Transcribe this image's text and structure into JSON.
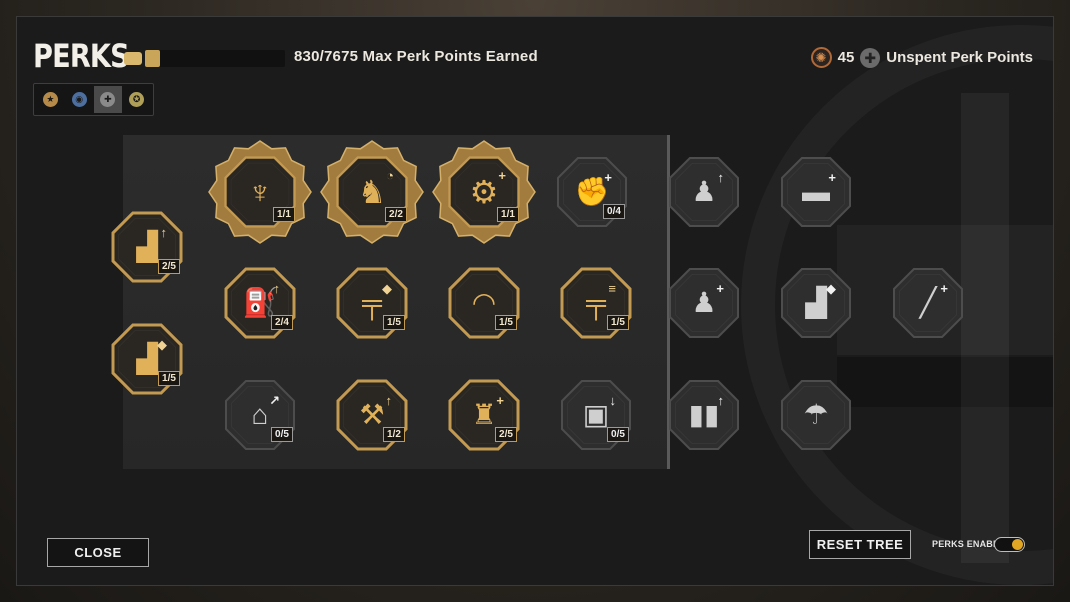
{
  "header": {
    "title": "PERKS",
    "points_text": "830/7675 Max Perk Points Earned",
    "points_progress": 0.108,
    "unspent_count": "45",
    "unspent_label": "Unspent Perk Points"
  },
  "factions": [
    {
      "name": "us-faction-icon",
      "color": "#b68b4a",
      "symbol": "★"
    },
    {
      "name": "uk-faction-icon",
      "color": "#4d6fa0",
      "symbol": "◉"
    },
    {
      "name": "german-faction-icon",
      "color": "#8a8a8a",
      "symbol": "✚"
    },
    {
      "name": "soviet-faction-icon",
      "color": "#b0a057",
      "symbol": "✪"
    }
  ],
  "perks": [
    {
      "glyph": "▟",
      "sub": "↑",
      "rank": "2/5",
      "state": "gold",
      "size": "normal"
    },
    {
      "glyph": "▟",
      "sub": "◆",
      "rank": "1/5",
      "state": "gold",
      "size": "normal"
    },
    {
      "glyph": "♆",
      "sub": "",
      "rank": "1/1",
      "state": "gold",
      "size": "big"
    },
    {
      "glyph": "♞",
      "sub": "◔",
      "rank": "2/2",
      "state": "gold",
      "size": "big"
    },
    {
      "glyph": "⚙",
      "sub": "+",
      "rank": "1/1",
      "state": "gold",
      "size": "big"
    },
    {
      "glyph": "✊",
      "sub": "+",
      "rank": "0/4",
      "state": "grey",
      "size": "normal"
    },
    {
      "glyph": "♟",
      "sub": "↑",
      "rank": "",
      "state": "grey",
      "size": "normal"
    },
    {
      "glyph": "▬",
      "sub": "+",
      "rank": "",
      "state": "grey",
      "size": "normal"
    },
    {
      "glyph": "⛽",
      "sub": "↑",
      "rank": "2/4",
      "state": "gold",
      "size": "normal"
    },
    {
      "glyph": "╤",
      "sub": "◆",
      "rank": "1/5",
      "state": "gold",
      "size": "normal"
    },
    {
      "glyph": "◠",
      "sub": "",
      "rank": "1/5",
      "state": "gold",
      "size": "normal"
    },
    {
      "glyph": "╤",
      "sub": "≡",
      "rank": "1/5",
      "state": "gold",
      "size": "normal"
    },
    {
      "glyph": "♟",
      "sub": "+",
      "rank": "",
      "state": "grey",
      "size": "normal"
    },
    {
      "glyph": "▟",
      "sub": "◆",
      "rank": "",
      "state": "grey",
      "size": "normal"
    },
    {
      "glyph": "╱",
      "sub": "+",
      "rank": "",
      "state": "grey",
      "size": "normal"
    },
    {
      "glyph": "⌂",
      "sub": "↗",
      "rank": "0/5",
      "state": "grey",
      "size": "normal"
    },
    {
      "glyph": "⚒",
      "sub": "↑",
      "rank": "1/2",
      "state": "gold",
      "size": "normal"
    },
    {
      "glyph": "♜",
      "sub": "+",
      "rank": "2/5",
      "state": "gold",
      "size": "normal"
    },
    {
      "glyph": "▣",
      "sub": "↓",
      "rank": "0/5",
      "state": "grey",
      "size": "normal"
    },
    {
      "glyph": "▮▮",
      "sub": "↑",
      "rank": "",
      "state": "grey",
      "size": "normal"
    },
    {
      "glyph": "☂",
      "sub": "",
      "rank": "",
      "state": "grey",
      "size": "normal"
    }
  ],
  "buttons": {
    "close": "CLOSE",
    "reset": "RESET TREE",
    "perks_enabled": "PERKS ENABLED"
  },
  "colors": {
    "gold": "#c39a52",
    "grey": "#9a9a9a",
    "toggle_on": "#e1a624"
  }
}
